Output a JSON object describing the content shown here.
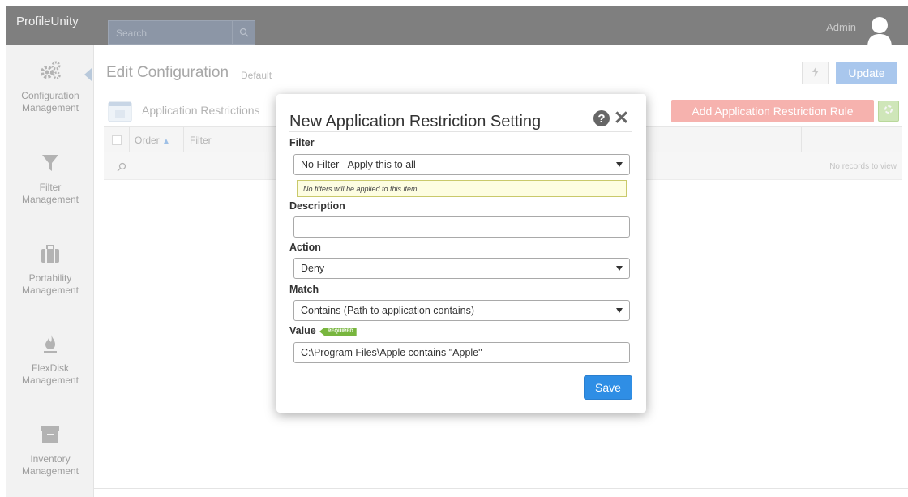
{
  "app": {
    "brand": "ProfileUnity"
  },
  "search": {
    "placeholder": "Search"
  },
  "user": {
    "name": "Admin"
  },
  "sidebar": {
    "items": [
      {
        "line1": "Configuration",
        "line2": "Management",
        "icon": "gears-icon"
      },
      {
        "line1": "Filter",
        "line2": "Management",
        "icon": "filter-icon"
      },
      {
        "line1": "Portability",
        "line2": "Management",
        "icon": "briefcase-icon"
      },
      {
        "line1": "FlexDisk",
        "line2": "Management",
        "icon": "flame-icon"
      },
      {
        "line1": "Inventory",
        "line2": "Management",
        "icon": "archive-icon"
      }
    ]
  },
  "header": {
    "title": "Edit Configuration",
    "subtitle": "Default",
    "bolt_icon": "bolt-icon",
    "update_label": "Update"
  },
  "panel": {
    "title": "Application Restrictions",
    "add_label": "Add Application Restriction Rule"
  },
  "grid": {
    "columns": [
      "Order",
      "Filter"
    ],
    "empty_text": "No records to view"
  },
  "modal": {
    "title": "New Application Restriction Setting",
    "filter_label": "Filter",
    "filter_value": "No Filter - Apply this to all",
    "filter_hint": "No filters will be applied to this item.",
    "description_label": "Description",
    "description_value": "",
    "action_label": "Action",
    "action_value": "Deny",
    "match_label": "Match",
    "match_value": "Contains (Path to application contains)",
    "value_label": "Value",
    "required_badge": "REQUIRED",
    "value_value": "C:\\Program Files\\Apple contains \"Apple\"",
    "save_label": "Save"
  },
  "colors": {
    "topbar": "#7f7f7f",
    "accent_blue": "#2f8ee5",
    "danger_pale": "#f6b2ae",
    "required_green": "#78b63e"
  }
}
